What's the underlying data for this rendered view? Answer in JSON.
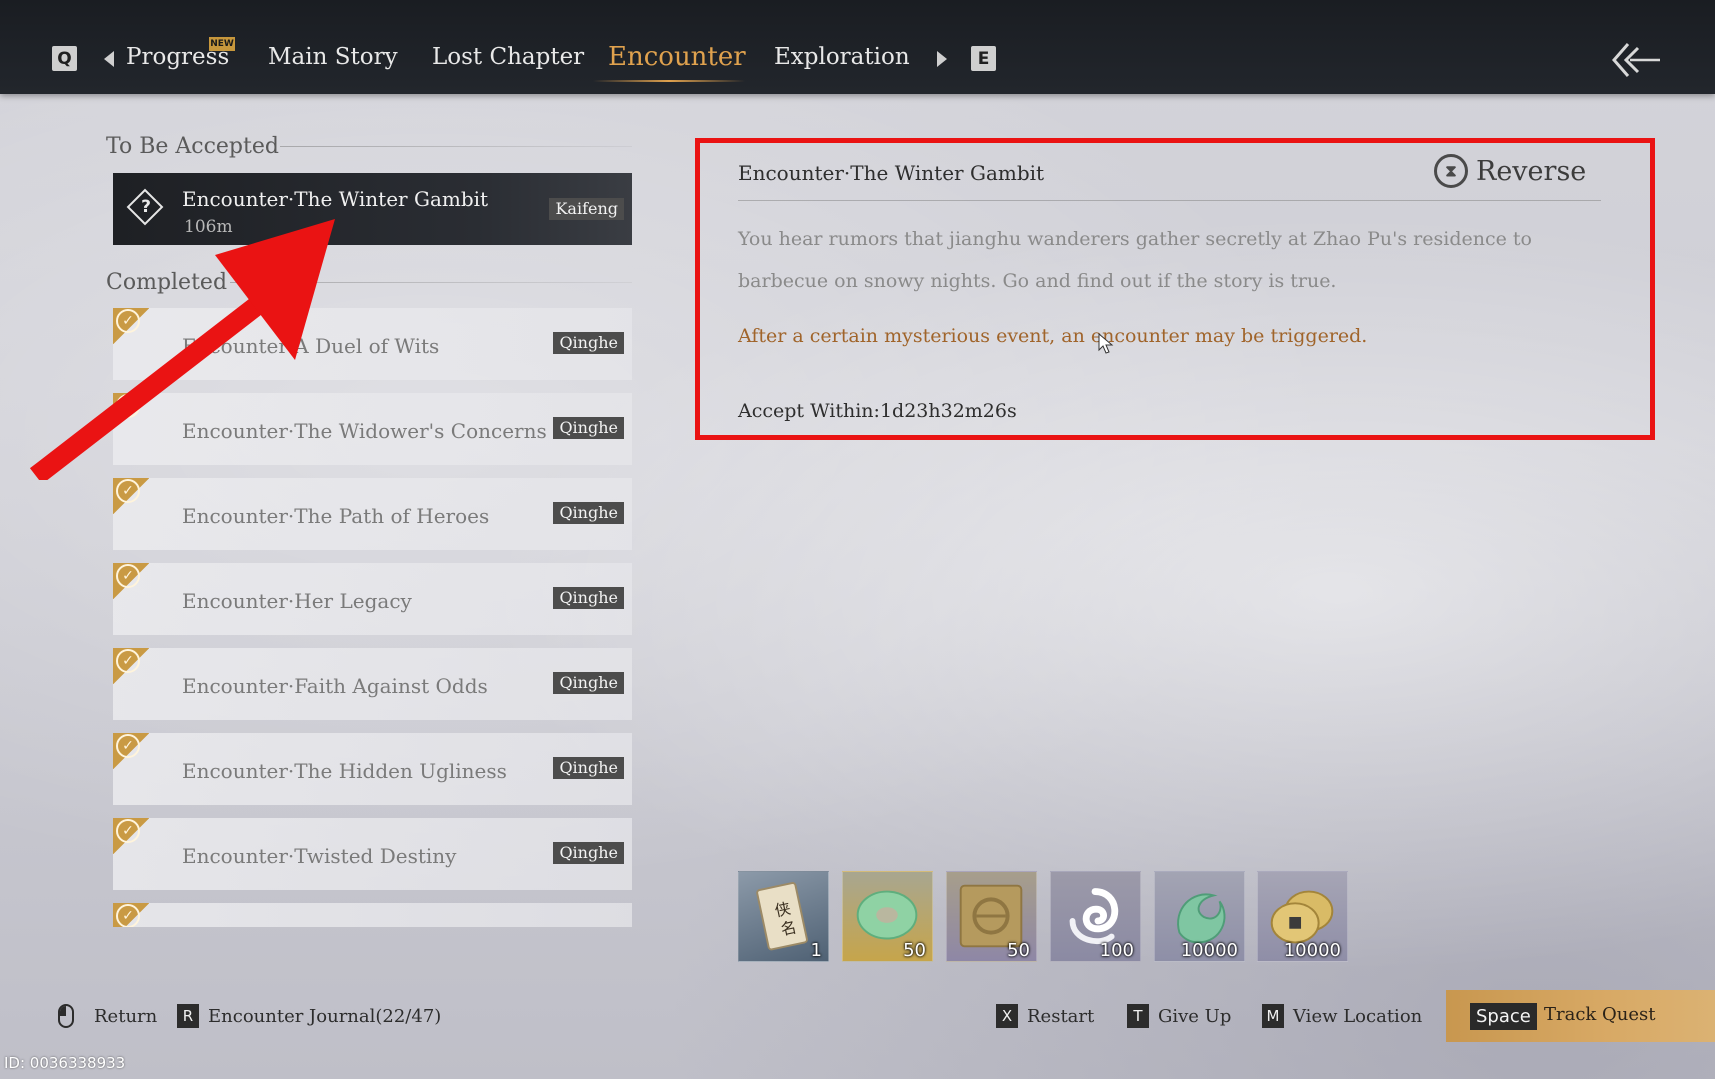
{
  "topbar": {
    "prev_key": "Q",
    "next_key": "E",
    "new_badge": "NEW",
    "tabs": [
      {
        "label": "Progress"
      },
      {
        "label": "Main Story"
      },
      {
        "label": "Lost Chapter"
      },
      {
        "label": "Encounter",
        "active": true
      },
      {
        "label": "Exploration"
      }
    ],
    "back_icon": "double-chevron-left-icon"
  },
  "sidebar": {
    "to_be_accepted_title": "To Be Accepted",
    "completed_title": "Completed",
    "active_quest": {
      "title": "Encounter·The Winter Gambit",
      "distance": "106m",
      "location": "Kaifeng",
      "icon": "question-diamond-icon"
    },
    "completed_quests": [
      {
        "title": "Encounter·A Duel of Wits",
        "location": "Qinghe"
      },
      {
        "title": "Encounter·The Widower's Concerns",
        "location": "Qinghe"
      },
      {
        "title": "Encounter·The Path of Heroes",
        "location": "Qinghe"
      },
      {
        "title": "Encounter·Her Legacy",
        "location": "Qinghe"
      },
      {
        "title": "Encounter·Faith Against Odds",
        "location": "Qinghe"
      },
      {
        "title": "Encounter·The Hidden Ugliness",
        "location": "Qinghe"
      },
      {
        "title": "Encounter·Twisted Destiny",
        "location": "Qinghe"
      }
    ]
  },
  "detail": {
    "title": "Encounter·The Winter Gambit",
    "reverse_label": "Reverse",
    "description": "You hear rumors that jianghu wanderers gather secretly at Zhao Pu's residence to barbecue on snowy nights. Go and find out if the story is true.",
    "hint": "After a certain mysterious event, an encounter may be triggered.",
    "timer": "Accept Within:1d23h32m26s",
    "highlight_color": "#ea1313"
  },
  "rewards": [
    {
      "icon": "scroll-icon",
      "qty": "1"
    },
    {
      "icon": "jade-ring-icon",
      "qty": "50"
    },
    {
      "icon": "gold-emblem-icon",
      "qty": "50"
    },
    {
      "icon": "swirl-icon",
      "qty": "100"
    },
    {
      "icon": "green-wave-icon",
      "qty": "10000"
    },
    {
      "icon": "coins-icon",
      "qty": "10000"
    }
  ],
  "bottombar": {
    "return_label": "Return",
    "journal_key": "R",
    "journal_label": "Encounter Journal(22/47)",
    "restart_key": "X",
    "restart_label": "Restart",
    "giveup_key": "T",
    "giveup_label": "Give Up",
    "location_key": "M",
    "location_label": "View Location",
    "track_key": "Space",
    "track_label": "Track Quest"
  },
  "uid": "ID: 0036338933",
  "annotation_arrow_color": "#ea1313"
}
